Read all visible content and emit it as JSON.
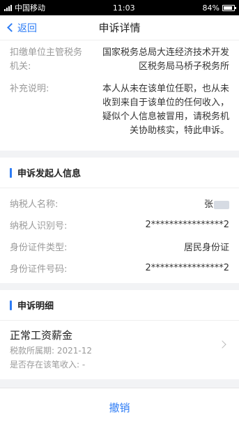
{
  "status_bar": {
    "carrier": "中国移动",
    "time": "11:03",
    "battery_percent": "84%",
    "battery_level": 0.84
  },
  "nav": {
    "back_label": "返回",
    "title": "申诉详情"
  },
  "tax_info": {
    "authority_label": "扣缴单位主管税务机关:",
    "authority_value": "国家税务总局大连经济技术开发区税务局马桥子税务所",
    "remark_label": "补充说明:",
    "remark_value": "本人从未在该单位任职，也从未收到来自于该单位的任何收入，疑似个人信息被冒用，请税务机关协助核实，特此申诉。"
  },
  "applicant": {
    "section_title": "申诉发起人信息",
    "name_label": "纳税人名称:",
    "name_value": "张",
    "id_label": "纳税人识别号:",
    "id_value": "2****************2",
    "doc_type_label": "身份证件类型:",
    "doc_type_value": "居民身份证",
    "doc_no_label": "身份证件号码:",
    "doc_no_value": "2****************2"
  },
  "details": {
    "section_title": "申诉明细",
    "item": {
      "title": "正常工资薪金",
      "period": "税款所属期: 2021-12",
      "income": "是否存在该笔收入: -"
    }
  },
  "footer": {
    "cancel_label": "撤销"
  },
  "colors": {
    "accent": "#2d7cf5",
    "background": "#f2f3f5"
  }
}
